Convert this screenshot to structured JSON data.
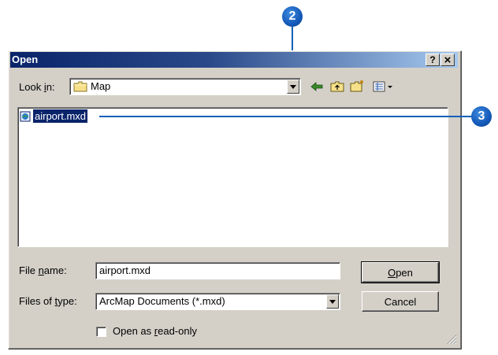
{
  "window": {
    "title": "Open"
  },
  "titlebar_buttons": {
    "help": "?",
    "close": "×"
  },
  "look_in": {
    "label_pre": "Look ",
    "label_accel": "i",
    "label_post": "n:",
    "value": "Map"
  },
  "toolbar": {
    "icons": [
      "back-arrow-icon",
      "up-one-level-icon",
      "create-new-folder-icon",
      "view-menu-icon"
    ]
  },
  "files": [
    {
      "name": "airport.mxd",
      "icon": "arcmap-document-icon",
      "selected": true
    }
  ],
  "file_name": {
    "label_pre": "File ",
    "label_accel": "n",
    "label_post": "ame:",
    "value": "airport.mxd"
  },
  "files_of_type": {
    "label_pre": "Files of ",
    "label_accel": "t",
    "label_post": "ype:",
    "value": "ArcMap Documents (*.mxd)"
  },
  "buttons": {
    "open_accel": "O",
    "open_rest": "pen",
    "cancel": "Cancel"
  },
  "read_only": {
    "label_pre": "Open as ",
    "label_accel": "r",
    "label_post": "ead-only",
    "checked": false
  },
  "callouts": {
    "two": "2",
    "three": "3"
  },
  "colors": {
    "titlebar_start": "#0a246a",
    "titlebar_end": "#a6caf0",
    "callout": "#1358b8",
    "selection": "#0a246a"
  }
}
